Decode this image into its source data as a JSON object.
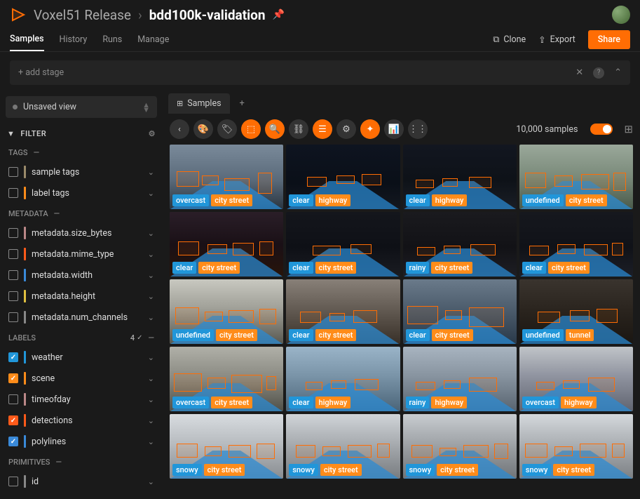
{
  "header": {
    "release": "Voxel51 Release",
    "dataset": "bdd100k-validation"
  },
  "tabs": {
    "items": [
      "Samples",
      "History",
      "Runs",
      "Manage"
    ],
    "active": 0,
    "clone": "Clone",
    "export": "Export",
    "share": "Share"
  },
  "stage": {
    "add": "+ add stage"
  },
  "view": {
    "label": "Unsaved view"
  },
  "filter_label": "FILTER",
  "sections": {
    "tags": {
      "label": "TAGS",
      "items": [
        {
          "label": "sample tags",
          "color": "#9a8a6a",
          "checked": false
        },
        {
          "label": "label tags",
          "color": "#ff8c1a",
          "checked": false
        }
      ]
    },
    "metadata": {
      "label": "METADATA",
      "items": [
        {
          "label": "metadata.size_bytes",
          "color": "#b88",
          "checked": false
        },
        {
          "label": "metadata.mime_type",
          "color": "#ff5a1a",
          "checked": false
        },
        {
          "label": "metadata.width",
          "color": "#3a8ad9",
          "checked": false
        },
        {
          "label": "metadata.height",
          "color": "#e0c040",
          "checked": false
        },
        {
          "label": "metadata.num_channels",
          "color": "#888",
          "checked": false
        }
      ]
    },
    "labels": {
      "label": "LABELS",
      "count": "4",
      "items": [
        {
          "label": "weather",
          "color": "#2196d9",
          "checked": true,
          "cbk": "#2196d9"
        },
        {
          "label": "scene",
          "color": "#ff8c1a",
          "checked": true,
          "cbk": "#ff8c1a"
        },
        {
          "label": "timeofday",
          "color": "#b88",
          "checked": false
        },
        {
          "label": "detections",
          "color": "#ff5a1a",
          "checked": true,
          "cbk": "#ff5a1a"
        },
        {
          "label": "polylines",
          "color": "#3a8ad9",
          "checked": true,
          "cbk": "#3a8ad9"
        }
      ]
    },
    "primitives": {
      "label": "PRIMITIVES",
      "items": [
        {
          "label": "id",
          "color": "#888",
          "checked": false
        }
      ]
    }
  },
  "content_tab": "Samples",
  "sample_count": "10,000 samples",
  "samples": [
    {
      "weather": "overcast",
      "scene": "city street",
      "bg": "linear-gradient(#7a8a9a 0%,#5a6a7a 55%,#2a3540 100%)",
      "night": false,
      "boxes": [
        [
          10,
          38,
          32,
          22
        ],
        [
          46,
          44,
          24,
          14
        ],
        [
          78,
          48,
          36,
          18
        ],
        [
          126,
          40,
          20,
          30
        ]
      ]
    },
    {
      "weather": "clear",
      "scene": "highway",
      "bg": "linear-gradient(#0e1420 0%,#0a0f18 60%,#141820 100%)",
      "night": true,
      "boxes": [
        [
          30,
          46,
          28,
          14
        ],
        [
          72,
          44,
          26,
          12
        ],
        [
          108,
          42,
          28,
          16
        ]
      ]
    },
    {
      "weather": "clear",
      "scene": "highway",
      "bg": "linear-gradient(#121620 0%,#0e1218 55%,#1a1e26 100%)",
      "night": true,
      "boxes": [
        [
          18,
          50,
          26,
          12
        ],
        [
          56,
          48,
          22,
          12
        ],
        [
          94,
          46,
          32,
          16
        ]
      ]
    },
    {
      "weather": "undefined",
      "scene": "city street",
      "bg": "linear-gradient(#9aa89a 0%,#7a8a7a 50%,#4a5a4a 100%)",
      "night": false,
      "boxes": [
        [
          8,
          40,
          30,
          22
        ],
        [
          50,
          44,
          26,
          16
        ],
        [
          88,
          42,
          40,
          22
        ],
        [
          134,
          40,
          18,
          26
        ]
      ]
    },
    {
      "weather": "clear",
      "scene": "city street",
      "bg": "linear-gradient(#2a1e28 0%,#1a1016 50%,#28140a 100%)",
      "night": true,
      "boxes": [
        [
          12,
          42,
          30,
          20
        ],
        [
          54,
          46,
          28,
          14
        ],
        [
          90,
          44,
          30,
          18
        ],
        [
          128,
          42,
          20,
          20
        ]
      ]
    },
    {
      "weather": "clear",
      "scene": "city street",
      "bg": "linear-gradient(#14161c 0%,#0e1016 55%,#1a1c22 100%)",
      "night": true,
      "boxes": [
        [
          38,
          48,
          40,
          14
        ],
        [
          92,
          46,
          30,
          14
        ]
      ]
    },
    {
      "weather": "rainy",
      "scene": "city street",
      "bg": "linear-gradient(#1a1a1e 0%,#121216 55%,#1e1e24 100%)",
      "night": true,
      "boxes": [
        [
          20,
          50,
          26,
          12
        ],
        [
          58,
          48,
          24,
          12
        ],
        [
          96,
          46,
          36,
          16
        ]
      ]
    },
    {
      "weather": "clear",
      "scene": "city street",
      "bg": "linear-gradient(#16181e 0%,#101218 55%,#1c1e26 100%)",
      "night": true,
      "boxes": [
        [
          14,
          48,
          28,
          14
        ],
        [
          54,
          46,
          26,
          14
        ],
        [
          92,
          46,
          34,
          16
        ],
        [
          132,
          44,
          16,
          18
        ]
      ]
    },
    {
      "weather": "undefined",
      "scene": "city street",
      "bg": "linear-gradient(#c8c8c0 0%,#a0a098 45%,#585850 100%)",
      "night": false,
      "boxes": [
        [
          8,
          40,
          34,
          24
        ],
        [
          50,
          46,
          26,
          14
        ],
        [
          84,
          44,
          36,
          18
        ],
        [
          128,
          42,
          24,
          22
        ]
      ]
    },
    {
      "weather": "clear",
      "scene": "city street",
      "bg": "linear-gradient(#888078 0%,#605850 50%,#383028 100%)",
      "night": false,
      "boxes": [
        [
          20,
          46,
          30,
          16
        ],
        [
          62,
          48,
          22,
          12
        ],
        [
          96,
          44,
          34,
          18
        ]
      ]
    },
    {
      "weather": "clear",
      "scene": "city street",
      "bg": "linear-gradient(#6a7a8a 0%,#4a5a6a 50%,#2a3a4a 100%)",
      "night": false,
      "boxes": [
        [
          6,
          38,
          44,
          26
        ],
        [
          60,
          44,
          24,
          14
        ],
        [
          94,
          40,
          50,
          28
        ]
      ]
    },
    {
      "weather": "undefined",
      "scene": "tunnel",
      "bg": "linear-gradient(#3a342e 0%,#28221c 55%,#1a1612 100%)",
      "night": true,
      "boxes": [
        [
          26,
          46,
          32,
          16
        ],
        [
          72,
          44,
          28,
          16
        ],
        [
          110,
          42,
          30,
          20
        ]
      ]
    },
    {
      "weather": "overcast",
      "scene": "city street",
      "bg": "linear-gradient(#b0b0a8 0%,#888880 50%,#505048 100%)",
      "night": false,
      "boxes": [
        [
          6,
          38,
          40,
          26
        ],
        [
          54,
          44,
          26,
          16
        ],
        [
          88,
          40,
          44,
          26
        ],
        [
          138,
          42,
          14,
          20
        ]
      ]
    },
    {
      "weather": "clear",
      "scene": "highway",
      "bg": "linear-gradient(#9ab4c8 0%,#7a94a8 45%,#4a6478 100%)",
      "night": false,
      "boxes": [
        [
          28,
          50,
          24,
          12
        ],
        [
          64,
          48,
          22,
          12
        ],
        [
          98,
          46,
          34,
          16
        ]
      ]
    },
    {
      "weather": "rainy",
      "scene": "highway",
      "bg": "linear-gradient(#a8b4c0 0%,#8894a0 45%,#586470 100%)",
      "night": false,
      "boxes": [
        [
          18,
          50,
          28,
          12
        ],
        [
          58,
          48,
          24,
          12
        ],
        [
          94,
          44,
          40,
          20
        ]
      ]
    },
    {
      "weather": "overcast",
      "scene": "highway",
      "bg": "linear-gradient(#c0c4c8 0%,#9094a0 45%,#606470 100%)",
      "night": false,
      "boxes": [
        [
          24,
          50,
          26,
          12
        ],
        [
          62,
          48,
          24,
          12
        ],
        [
          98,
          44,
          38,
          20
        ]
      ]
    },
    {
      "weather": "snowy",
      "scene": "city street",
      "bg": "linear-gradient(#d8dce0 0%,#b8bcc0 45%,#888c90 100%)",
      "night": false,
      "boxes": [
        [
          10,
          42,
          30,
          20
        ],
        [
          50,
          46,
          24,
          14
        ],
        [
          84,
          44,
          32,
          18
        ],
        [
          124,
          42,
          26,
          22
        ]
      ]
    },
    {
      "weather": "snowy",
      "scene": "city street",
      "bg": "linear-gradient(#d0d4d8 0%,#a8acb0 45%,#787c80 100%)",
      "night": false,
      "boxes": [
        [
          14,
          44,
          28,
          18
        ],
        [
          52,
          46,
          26,
          14
        ],
        [
          88,
          44,
          34,
          18
        ],
        [
          130,
          42,
          18,
          20
        ]
      ]
    },
    {
      "weather": "snowy",
      "scene": "city street",
      "bg": "linear-gradient(#c8ccd0 0%,#a0a4a8 45%,#707478 100%)",
      "night": false,
      "boxes": [
        [
          12,
          44,
          30,
          18
        ],
        [
          52,
          48,
          24,
          12
        ],
        [
          86,
          44,
          36,
          18
        ],
        [
          130,
          42,
          20,
          22
        ]
      ]
    },
    {
      "weather": "snowy",
      "scene": "city street",
      "bg": "linear-gradient(#d4d8dc 0%,#acb0b4 45%,#7c8084 100%)",
      "night": false,
      "boxes": [
        [
          8,
          42,
          32,
          20
        ],
        [
          50,
          46,
          26,
          14
        ],
        [
          86,
          42,
          38,
          20
        ],
        [
          132,
          42,
          18,
          20
        ]
      ]
    }
  ]
}
